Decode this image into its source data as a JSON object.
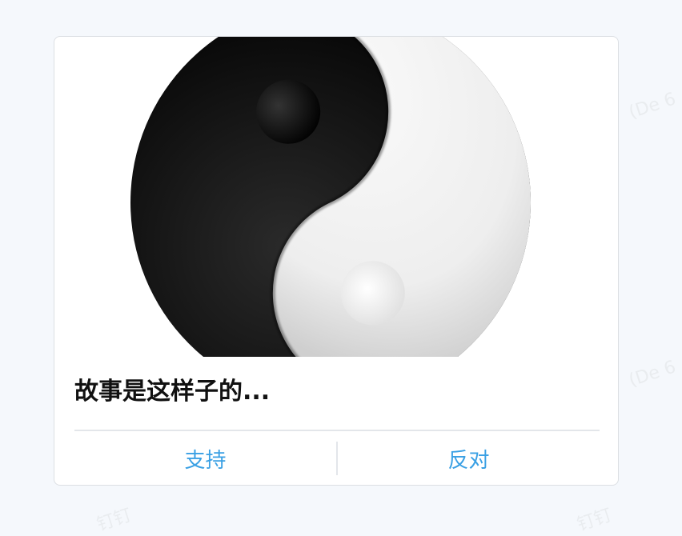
{
  "background": {
    "watermarks": [
      "(De 6",
      "(De 6",
      "钉钉",
      "钉钉"
    ]
  },
  "card": {
    "image": {
      "subject": "yin-yang-symbol"
    },
    "title": "故事是这样子的...",
    "actions": [
      {
        "label": "支持"
      },
      {
        "label": "反对"
      }
    ]
  },
  "colors": {
    "accent": "#3aa0e4",
    "title": "#111111",
    "page_background": "#f5f8fc"
  }
}
